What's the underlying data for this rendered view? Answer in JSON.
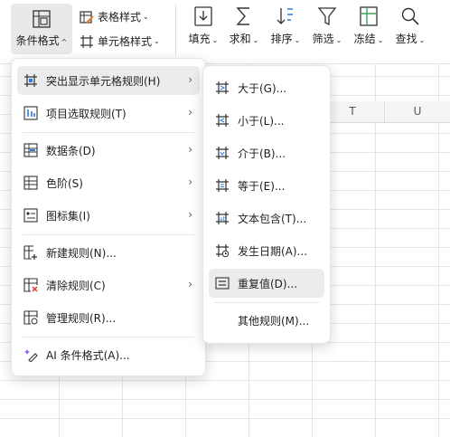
{
  "ribbon": {
    "conditional_format": "条件格式",
    "table_style": "表格样式",
    "cell_style": "单元格样式",
    "fill": "填充",
    "sum": "求和",
    "sort": "排序",
    "filter": "筛选",
    "freeze": "冻结",
    "find": "查找"
  },
  "columns": [
    "T",
    "U"
  ],
  "menu": {
    "items": [
      {
        "label": "突出显示单元格规则(H)",
        "icon": "highlight-rules-icon"
      },
      {
        "label": "项目选取规则(T)",
        "icon": "top-bottom-icon"
      },
      {
        "label": "数据条(D)",
        "icon": "data-bars-icon"
      },
      {
        "label": "色阶(S)",
        "icon": "color-scale-icon"
      },
      {
        "label": "图标集(I)",
        "icon": "icon-sets-icon"
      },
      {
        "label": "新建规则(N)...",
        "icon": "new-rule-icon"
      },
      {
        "label": "清除规则(C)",
        "icon": "clear-rules-icon"
      },
      {
        "label": "管理规则(R)...",
        "icon": "manage-rules-icon"
      },
      {
        "label": "AI 条件格式(A)...",
        "icon": "ai-format-icon"
      }
    ]
  },
  "submenu": {
    "items": [
      {
        "label": "大于(G)...",
        "icon": "greater-than-icon"
      },
      {
        "label": "小于(L)...",
        "icon": "less-than-icon"
      },
      {
        "label": "介于(B)...",
        "icon": "between-icon"
      },
      {
        "label": "等于(E)...",
        "icon": "equal-to-icon"
      },
      {
        "label": "文本包含(T)...",
        "icon": "text-contains-icon"
      },
      {
        "label": "发生日期(A)...",
        "icon": "date-occurring-icon"
      },
      {
        "label": "重复值(D)...",
        "icon": "duplicate-values-icon"
      },
      {
        "label": "其他规则(M)...",
        "icon": ""
      }
    ]
  }
}
